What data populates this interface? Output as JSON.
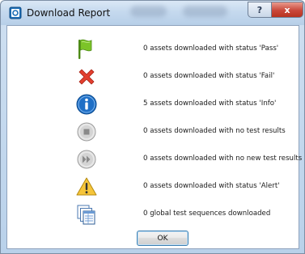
{
  "window": {
    "title": "Download Report",
    "help_label": "?",
    "close_label": "x"
  },
  "rows": [
    {
      "icon": "green-flag-icon",
      "text": "0 assets downloaded with status 'Pass'"
    },
    {
      "icon": "red-x-icon",
      "text": "0 assets downloaded with status 'Fail'"
    },
    {
      "icon": "info-icon",
      "text": "5 assets downloaded with status 'Info'"
    },
    {
      "icon": "no-results-icon",
      "text": "0 assets downloaded with no test results"
    },
    {
      "icon": "no-new-results-icon",
      "text": "0 assets downloaded with no new test results"
    },
    {
      "icon": "warning-icon",
      "text": "0 assets downloaded with status 'Alert'"
    },
    {
      "icon": "sequences-icon",
      "text": "0 global test sequences downloaded"
    }
  ],
  "ok_label": "OK",
  "colors": {
    "flag": "#6fb81f",
    "fail": "#e03a2a",
    "info": "#1f6fc6",
    "warning": "#f4c430",
    "accent": "#3c7fb1"
  }
}
